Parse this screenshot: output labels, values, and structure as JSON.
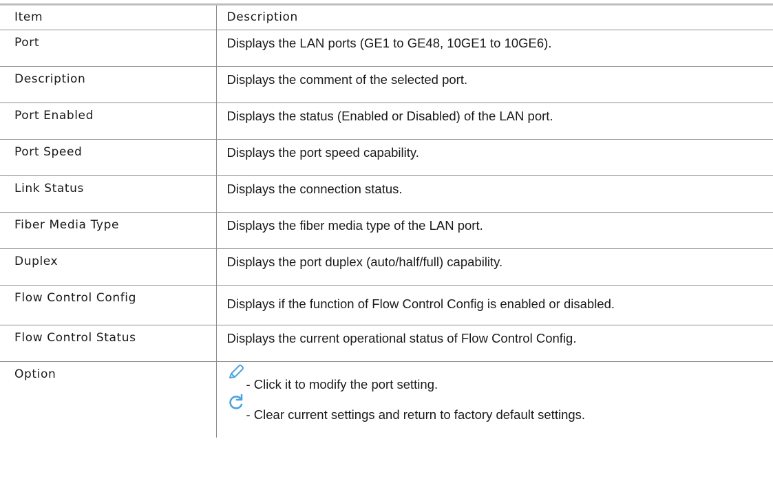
{
  "table": {
    "header": {
      "item": "Item",
      "description": "Description"
    },
    "rows": [
      {
        "item": "Port",
        "description": "Displays the LAN ports (GE1 to GE48, 10GE1 to 10GE6)."
      },
      {
        "item": "Description",
        "description": "Displays the comment of the selected port."
      },
      {
        "item": "Port Enabled",
        "description": "Displays the status (Enabled or Disabled) of the LAN port."
      },
      {
        "item": "Port Speed",
        "description": "Displays the port speed capability."
      },
      {
        "item": "Link Status",
        "description": "Displays the connection status."
      },
      {
        "item": "Fiber Media Type",
        "description": "Displays the fiber media type of the LAN port."
      },
      {
        "item": "Duplex",
        "description": "Displays the port duplex (auto/half/full) capability."
      },
      {
        "item": "Flow Control Config",
        "description": "Displays if the function of Flow Control Config is enabled or disabled."
      },
      {
        "item": "Flow Control Status",
        "description": "Displays the current operational status of Flow Control Config."
      }
    ],
    "option": {
      "item": "Option",
      "entries": [
        {
          "icon": "pencil-icon",
          "text": " - Click it to modify the port setting."
        },
        {
          "icon": "refresh-icon",
          "text": " - Clear current settings and return to factory default settings."
        }
      ]
    }
  },
  "colors": {
    "icon_blue": "#4aa3df",
    "border": "#8c8c8c",
    "top_rule": "#bdbdbd"
  }
}
